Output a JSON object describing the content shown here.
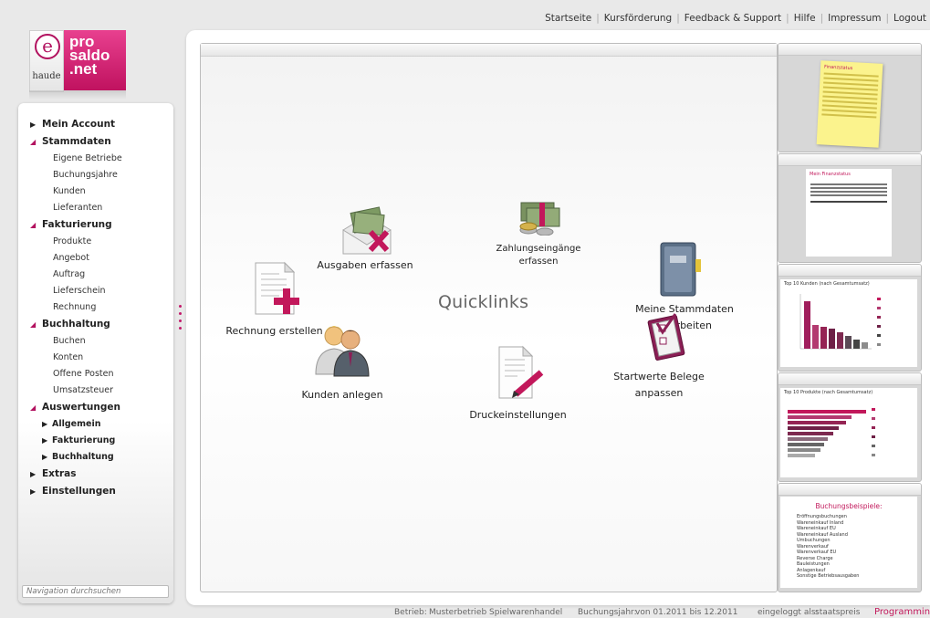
{
  "topnav": {
    "items": [
      "Startseite",
      "Kursförderung",
      "Feedback & Support",
      "Hilfe",
      "Impressum",
      "Logout"
    ]
  },
  "logo": {
    "e": "e",
    "haude": "haude",
    "pro": "pro",
    "saldo": "saldo",
    "net": ".net"
  },
  "sidebar": {
    "items": [
      {
        "label": "Mein Account",
        "level": 1,
        "state": "closed"
      },
      {
        "label": "Stammdaten",
        "level": 1,
        "state": "open"
      },
      {
        "label": "Eigene Betriebe",
        "level": 2
      },
      {
        "label": "Buchungsjahre",
        "level": 2
      },
      {
        "label": "Kunden",
        "level": 2
      },
      {
        "label": "Lieferanten",
        "level": 2
      },
      {
        "label": "Fakturierung",
        "level": 1,
        "state": "open"
      },
      {
        "label": "Produkte",
        "level": 2
      },
      {
        "label": "Angebot",
        "level": 2
      },
      {
        "label": "Auftrag",
        "level": 2
      },
      {
        "label": "Lieferschein",
        "level": 2
      },
      {
        "label": "Rechnung",
        "level": 2
      },
      {
        "label": "Buchhaltung",
        "level": 1,
        "state": "open"
      },
      {
        "label": "Buchen",
        "level": 2
      },
      {
        "label": "Konten",
        "level": 2
      },
      {
        "label": "Offene Posten",
        "level": 2
      },
      {
        "label": "Umsatzsteuer",
        "level": 2
      },
      {
        "label": "Auswertungen",
        "level": 1,
        "state": "open"
      },
      {
        "label": "Allgemein",
        "level": "2b",
        "state": "closed"
      },
      {
        "label": "Fakturierung",
        "level": "2b",
        "state": "closed"
      },
      {
        "label": "Buchhaltung",
        "level": "2b",
        "state": "closed"
      },
      {
        "label": "Extras",
        "level": 1,
        "state": "closed"
      },
      {
        "label": "Einstellungen",
        "level": 1,
        "state": "closed"
      }
    ],
    "search_placeholder": "Navigation durchsuchen"
  },
  "quicklinks": {
    "title": "Quicklinks",
    "ausgaben": "Ausgaben erfassen",
    "zahlungseingaenge_1": "Zahlungseingänge",
    "zahlungseingaenge_2": "erfassen",
    "rechnung": "Rechnung erstellen",
    "stammdaten_1": "Meine Stammdaten",
    "stammdaten_2": "bearbeiten",
    "kunden": "Kunden anlegen",
    "startwerte_1": "Startwerte Belege",
    "startwerte_2": "anpassen",
    "druck": "Druckeinstellungen"
  },
  "previews": {
    "finanzstatus_title": "Finanzstatus",
    "finanzuebersicht_title": "Mein Finanzstatus",
    "chart1_title": "Top 10 Kunden (nach Gesamtumsatz)",
    "chart2_title": "Top 10 Produkte (nach Gesamtumsatz)",
    "buchungsbeispiele_title": "Buchungsbeispiele:",
    "buchungsbeispiele_items": [
      "Eröffnungsbuchungen",
      "Wareneinkauf Inland",
      "Wareneinkauf EU",
      "Wareneinkauf Ausland",
      "Umbuchungen",
      "Warenverkauf",
      "Warenverkauf EU",
      "Reverse Charge",
      "Bauleistungen",
      "Anlagenkauf",
      "Sonstige Betriebsausgaben"
    ]
  },
  "status": {
    "betrieb_label": "Betrieb:",
    "betrieb_value": "Musterbetrieb Spielwarenhandel",
    "jahr_label": "Buchungsjahr:",
    "jahr_value": "von 01.2011 bis 12.2011",
    "login_label": "eingeloggt als:",
    "login_value": "staatspreis",
    "programminfo": "Programminfo"
  },
  "colors": {
    "accent": "#c2185b",
    "background": "#e9e9e9"
  }
}
